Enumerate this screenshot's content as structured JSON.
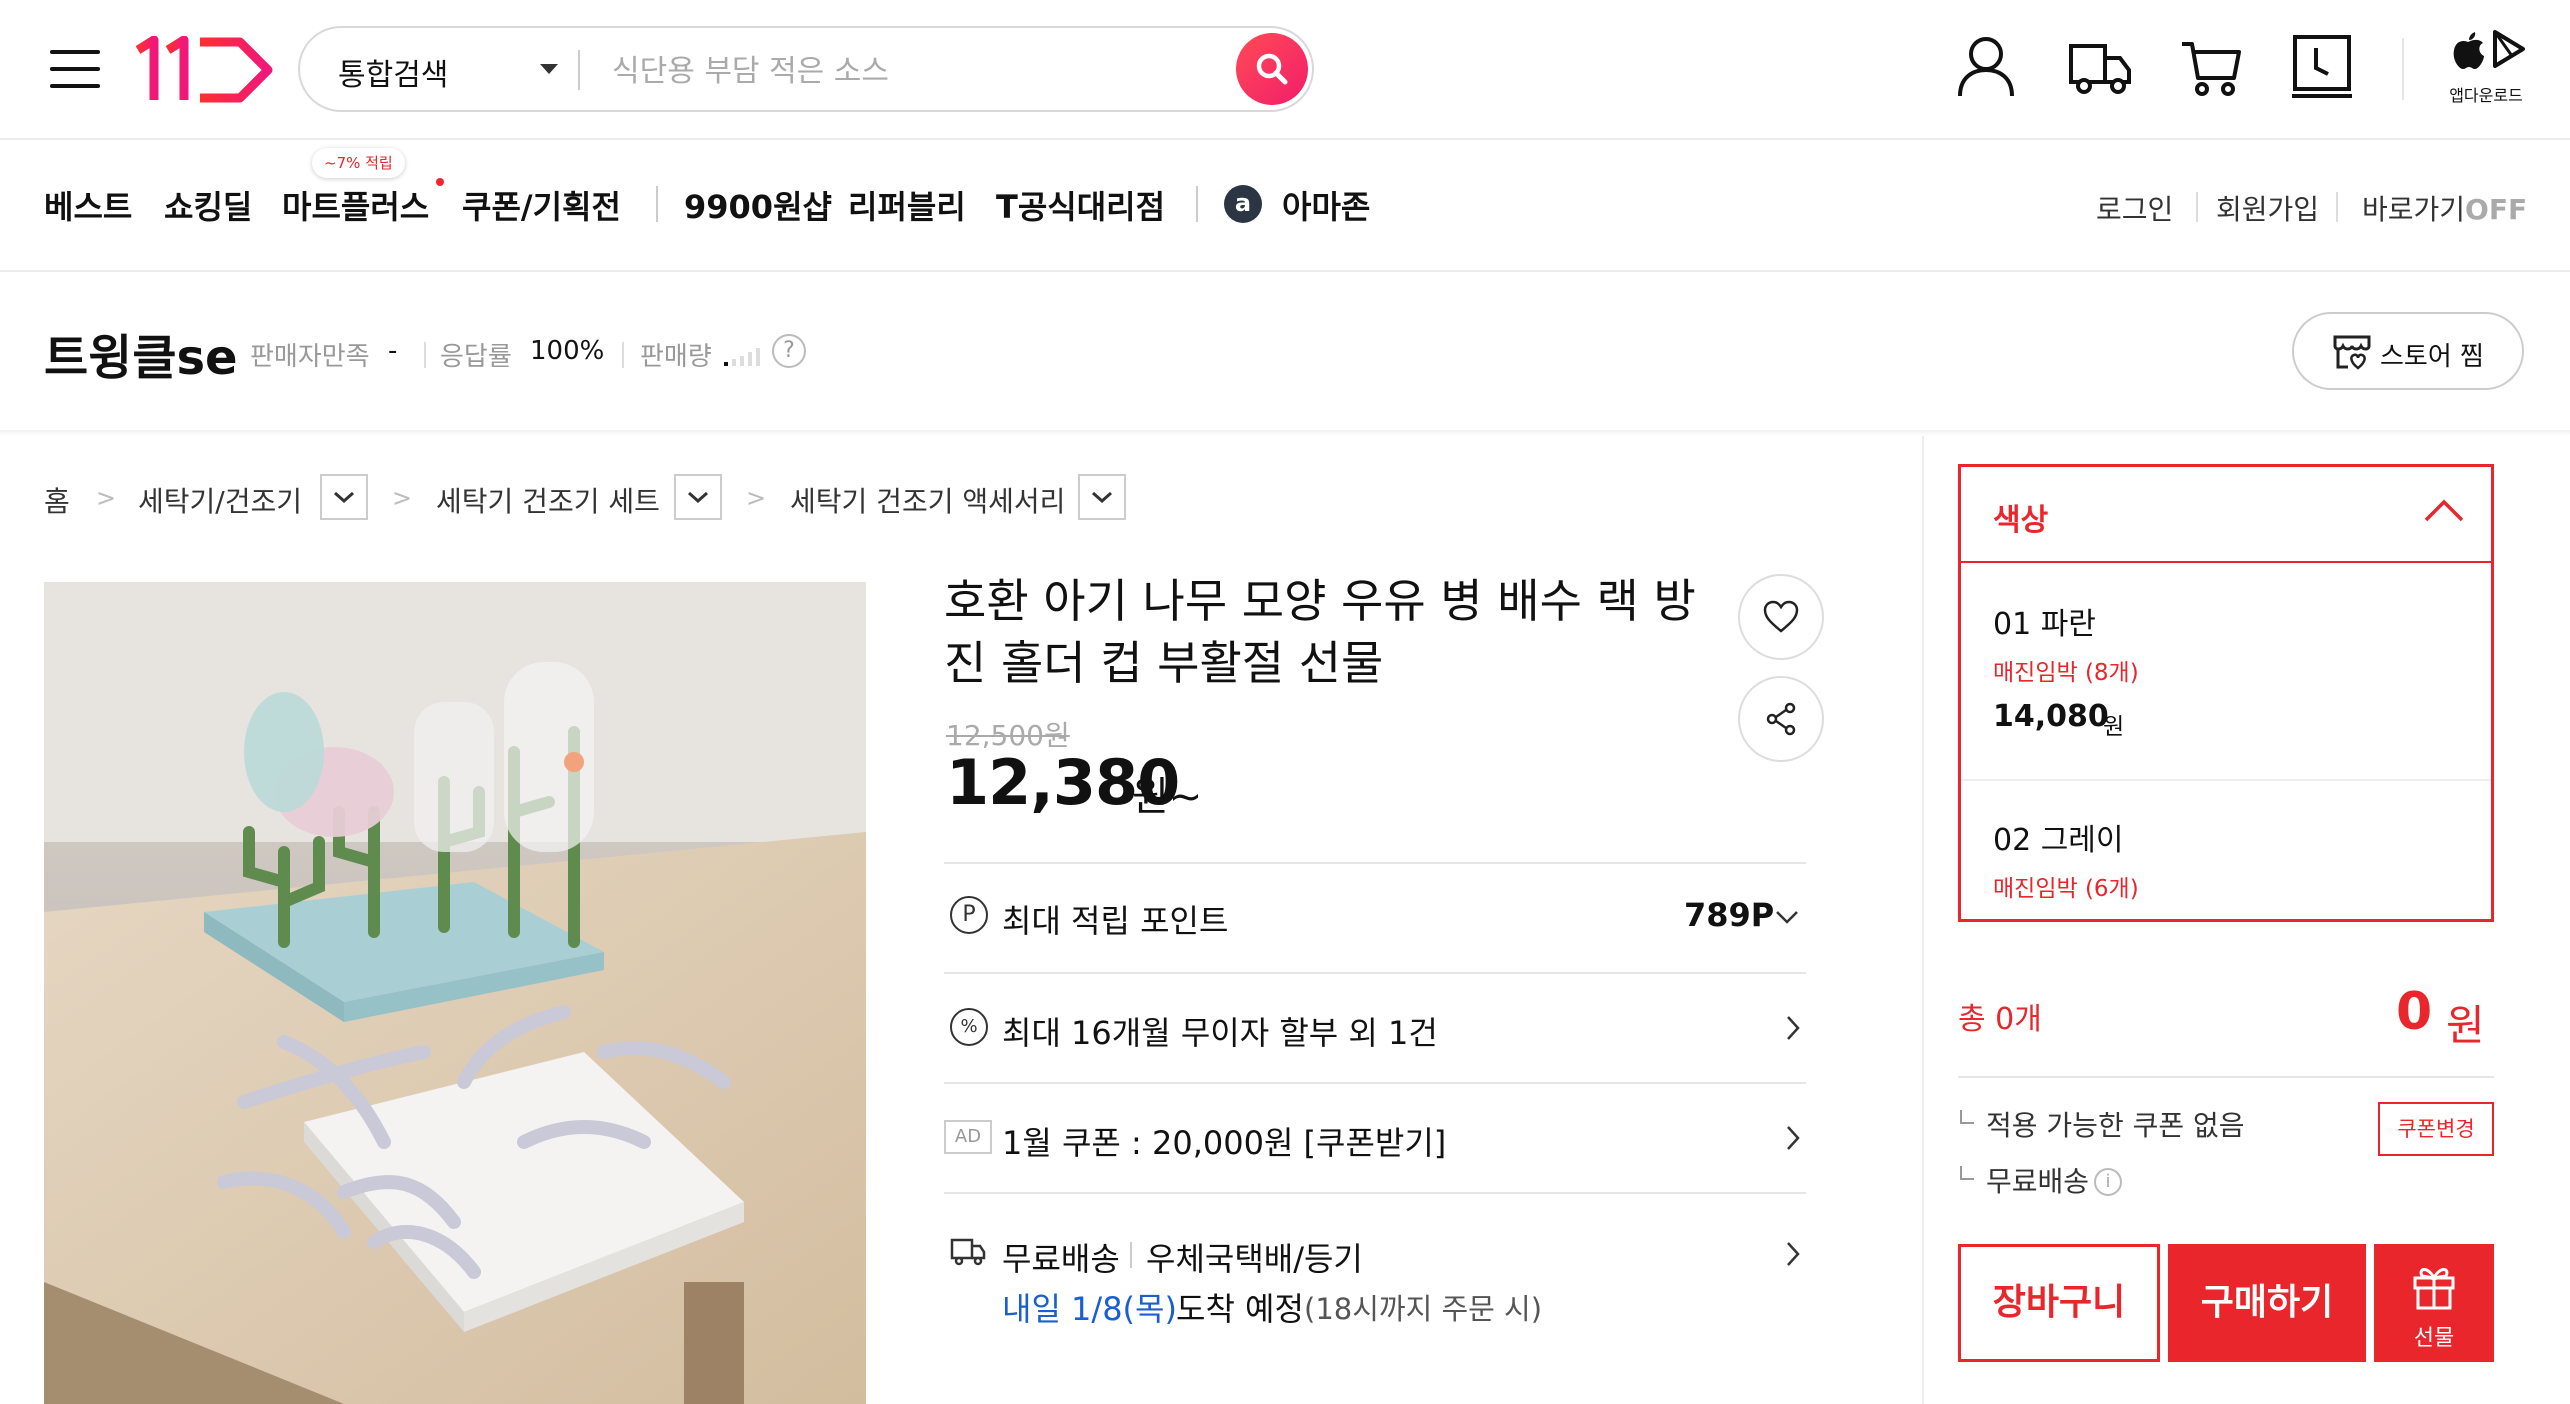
{
  "header": {
    "search": {
      "category": "통합검색",
      "placeholder": "식단용 부담 적은 소스"
    },
    "app_download_label": "앱다운로드"
  },
  "nav": {
    "items": [
      "베스트",
      "쇼킹딜",
      "마트플러스",
      "쿠폰/기획전",
      "9900원샵",
      "리퍼블리",
      "T공식대리점",
      "아마존"
    ],
    "badge": "~7% 적립",
    "amazon_icon_letter": "a",
    "utility": {
      "login": "로그인",
      "signup": "회원가입",
      "shortcut": "바로가기",
      "shortcut_state": "OFF"
    }
  },
  "seller": {
    "name": "트윙클se",
    "satisfaction_label": "판매자만족",
    "satisfaction_value": "-",
    "response_label": "응답률",
    "response_value": "100%",
    "sales_label": "판매량",
    "store_button": "스토어 찜"
  },
  "breadcrumb": [
    "홈",
    "세탁기/건조기",
    "세탁기 건조기 세트",
    "세탁기 건조기 액세서리"
  ],
  "product": {
    "title": "호환 아기 나무 모양 우유 병 배수 랙 방진 홀더 컵 부활절 선물",
    "original_price": "12,500원",
    "price": "12,380",
    "price_unit": "원~",
    "points_label": "최대 적립 포인트",
    "points_value": "789P",
    "installment": "최대 16개월 무이자 할부 외 1건",
    "ad_tag": "AD",
    "coupon": "1월 쿠폰 : 20,000원 [쿠폰받기]",
    "shipping_free": "무료배송",
    "shipping_method": "우체국택배/등기",
    "delivery_date": "내일 1/8(목)",
    "delivery_arrival": "도착 예정",
    "delivery_note": "(18시까지 주문 시)"
  },
  "options": {
    "header": "색상",
    "items": [
      {
        "name": "01 파란",
        "stock": "매진임박 (8개)",
        "price": "14,080",
        "unit": "원"
      },
      {
        "name": "02 그레이",
        "stock": "매진임박 (6개)"
      }
    ]
  },
  "summary": {
    "total_label": "총 0개",
    "total_value": "0",
    "total_unit": "원",
    "coupon_note": "적용 가능한 쿠폰 없음",
    "coupon_button": "쿠폰변경",
    "shipping_note": "무료배송"
  },
  "actions": {
    "cart": "장바구니",
    "buy": "구매하기",
    "gift": "선물"
  },
  "colors": {
    "accent": "#e8262b",
    "link_blue": "#1a5fd0",
    "logo_red": "#ff3a3a"
  }
}
